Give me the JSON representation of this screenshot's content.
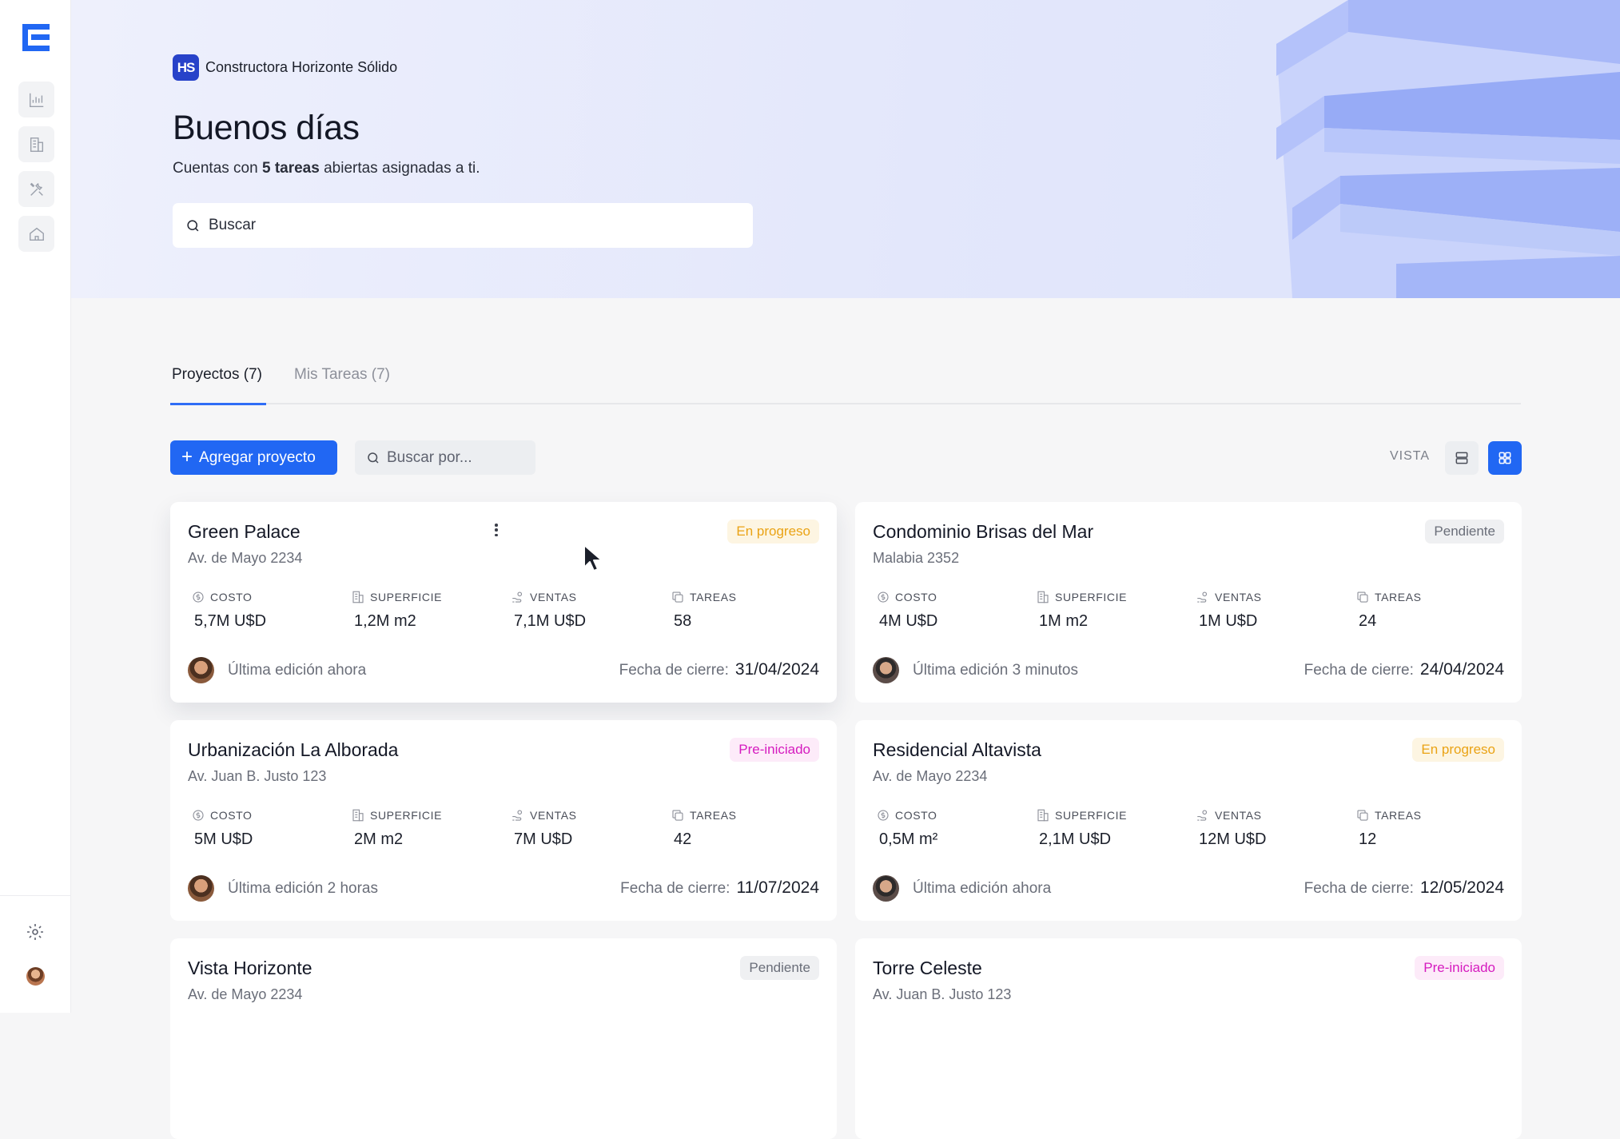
{
  "sidebar": {
    "items": [
      "reports-icon",
      "buildings-icon",
      "tools-icon",
      "home-icon"
    ],
    "bottom": [
      "gear-icon",
      "user-avatar"
    ]
  },
  "hero": {
    "company_initials": "HS",
    "company_name": "Constructora Horizonte Sólido",
    "greeting": "Buenos días",
    "subtitle_prefix": "Cuentas con ",
    "subtitle_bold": "5 tareas",
    "subtitle_suffix": " abiertas asignadas a ti.",
    "search_placeholder": "Buscar"
  },
  "tabs": [
    {
      "label": "Proyectos (7)",
      "active": true
    },
    {
      "label": "Mis Tareas (7)",
      "active": false
    }
  ],
  "toolbar": {
    "add_label": "Agregar proyecto",
    "search_placeholder": "Buscar por...",
    "view_label": "VISTA"
  },
  "stat_labels": {
    "cost": "COSTO",
    "area": "SUPERFICIE",
    "sales": "VENTAS",
    "tasks": "TAREAS"
  },
  "close_label": "Fecha de cierre:",
  "projects": [
    {
      "name": "Green Palace",
      "address": "Av. de Mayo 2234",
      "status": "En progreso",
      "status_type": "progress",
      "cost": "5,7M U$D",
      "area": "1,2M m2",
      "sales": "7,1M U$D",
      "tasks": "58",
      "edited": "Última edición ahora",
      "close_date": "31/04/2024"
    },
    {
      "name": "Condominio Brisas del Mar",
      "address": "Malabia 2352",
      "status": "Pendiente",
      "status_type": "pending",
      "cost": "4M U$D",
      "area": "1M m2",
      "sales": "1M U$D",
      "tasks": "24",
      "edited": "Última edición 3 minutos",
      "close_date": "24/04/2024"
    },
    {
      "name": "Urbanización La Alborada",
      "address": "Av. Juan B. Justo 123",
      "status": "Pre-iniciado",
      "status_type": "pre",
      "cost": "5M U$D",
      "area": "2M m2",
      "sales": "7M U$D",
      "tasks": "42",
      "edited": "Última edición 2 horas",
      "close_date": "11/07/2024"
    },
    {
      "name": "Residencial Altavista",
      "address": "Av. de Mayo 2234",
      "status": "En progreso",
      "status_type": "progress",
      "cost": "0,5M m²",
      "area": "2,1M U$D",
      "sales": "12M U$D",
      "tasks": "12",
      "edited": "Última edición ahora",
      "close_date": "12/05/2024"
    },
    {
      "name": "Vista Horizonte",
      "address": "Av. de Mayo 2234",
      "status": "Pendiente",
      "status_type": "pending"
    },
    {
      "name": "Torre Celeste",
      "address": "Av. Juan B. Justo 123",
      "status": "Pre-iniciado",
      "status_type": "pre"
    }
  ],
  "colors": {
    "primary": "#2167f3",
    "brand": "#2742c9",
    "progress": "#eaa315",
    "pre": "#d51bbf"
  }
}
